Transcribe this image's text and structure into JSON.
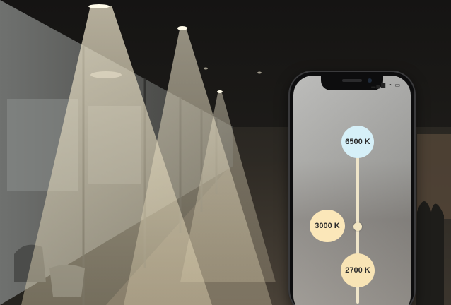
{
  "scene": {
    "description_free": true
  },
  "phone": {
    "status_text": "▂▄▆ ◔ ▭",
    "temperatures": {
      "cool": "6500 K",
      "neutral": "3000 K",
      "warm": "2700 K"
    },
    "colors": {
      "cool_bubble": "#d6f0f8",
      "warm_bubble": "#f8e4b5",
      "track": "#efe5c9"
    }
  }
}
